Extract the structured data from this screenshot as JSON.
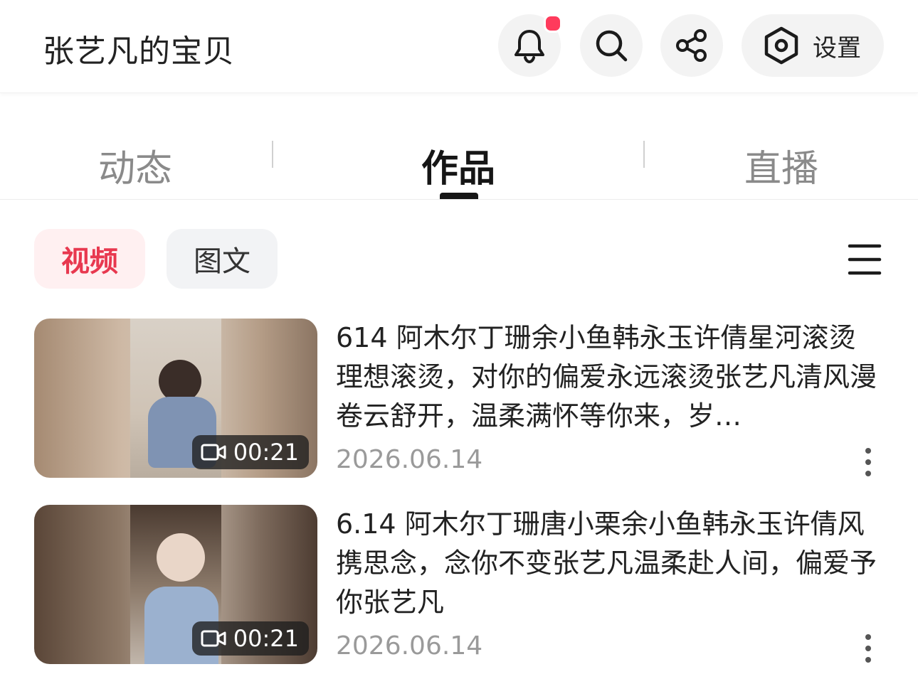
{
  "header": {
    "title": "张艺凡的宝贝",
    "settings_label": "设置",
    "icons": [
      "bell-icon",
      "search-icon",
      "share-icon",
      "settings-icon"
    ],
    "has_notification_badge": true
  },
  "tabs": [
    {
      "label": "动态",
      "active": false
    },
    {
      "label": "作品",
      "active": true
    },
    {
      "label": "直播",
      "active": false
    }
  ],
  "filters": {
    "video_label": "视频",
    "text_label": "图文",
    "selected": "视频"
  },
  "items": [
    {
      "description": "614 阿木尔丁珊余小鱼韩永玉许倩星河滚烫理想滚烫，对你的偏爱永远滚烫张艺凡清风漫卷云舒开，温柔满怀等你来，岁…",
      "duration": "00:21",
      "date": "2026.06.14"
    },
    {
      "description": "6.14 阿木尔丁珊唐小栗余小鱼韩永玉许倩风携思念，念你不变张艺凡温柔赴人间，偏爱予你张艺凡",
      "duration": "00:21",
      "date": "2026.06.14"
    }
  ],
  "colors": {
    "accent": "#e8384f",
    "badge": "#ff3b5c",
    "chip_active_bg": "#fff0f1",
    "chip_bg": "#f2f3f5"
  }
}
